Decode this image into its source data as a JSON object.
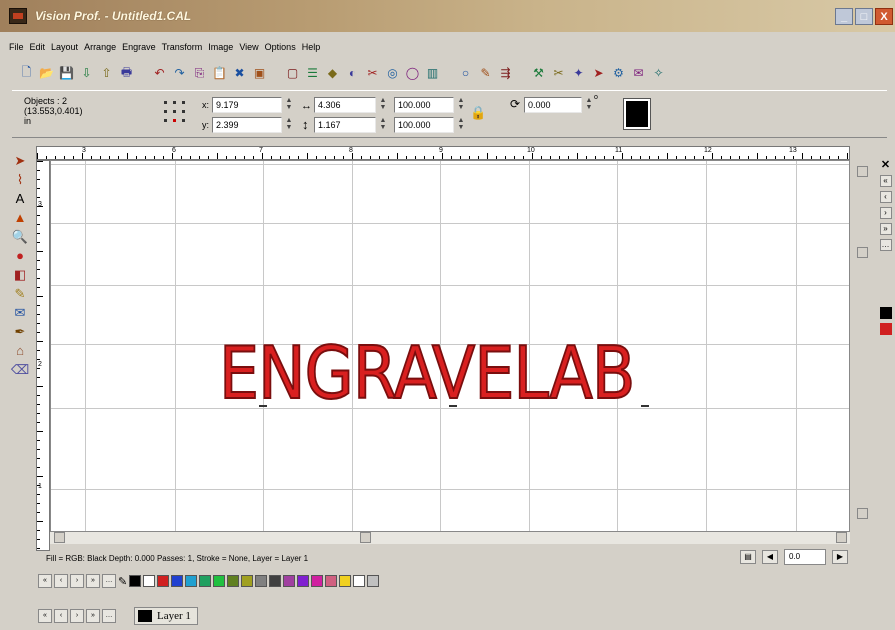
{
  "window": {
    "title": "Vision Prof. - Untitled1.CAL",
    "minimize": "_",
    "maximize": "□",
    "close": "X"
  },
  "menu": [
    "File",
    "Edit",
    "Layout",
    "Arrange",
    "Engrave",
    "Transform",
    "Image",
    "View",
    "Options",
    "Help"
  ],
  "toolbar_icons": [
    "new-icon",
    "open-icon",
    "save-icon",
    "import-icon",
    "export-icon",
    "print-icon",
    "undo-icon",
    "redo-icon",
    "copy-icon",
    "paste-icon",
    "delete-icon",
    "group-icon",
    "ungroup-icon",
    "align-icon",
    "node-icon",
    "weld-icon",
    "trim-icon",
    "intersect-icon",
    "contour-icon",
    "shadow-icon",
    "circle-icon",
    "engrave-icon",
    "output-icon",
    "tool-icon",
    "cut-icon",
    "plot-icon",
    "send-icon",
    "settings-icon",
    "mail-icon",
    "wand-icon"
  ],
  "props": {
    "objects_label": "Objects : 2",
    "objects_coords": "(13.553,0.401)",
    "objects_unit": "in",
    "x_label": "x:",
    "x_value": "9.179",
    "y_label": "y:",
    "y_value": "2.399",
    "w_value": "4.306",
    "h_value": "1.167",
    "sx_value": "100.000",
    "sy_value": "100.000",
    "rotation_value": "0.000",
    "rotation_unit": "o",
    "fill_color": "#000000"
  },
  "left_tools": [
    "pointer-icon",
    "node-edit-icon",
    "text-icon",
    "shape-icon",
    "zoom-icon",
    "fill-icon",
    "outline-icon",
    "draw-icon",
    "envelope-icon",
    "knife-icon",
    "stamp-icon",
    "eraser-icon"
  ],
  "ruler": {
    "h_labels": [
      "3",
      "6",
      "7",
      "8",
      "9",
      "10",
      "11",
      "12",
      "13"
    ],
    "v_labels": [
      "3",
      "2",
      "1"
    ]
  },
  "canvas": {
    "text": "ENGRAVELAB",
    "text_fill": "#d92020",
    "text_stroke": "#7a0e0e"
  },
  "status": {
    "text": "Fill = RGB: Black Depth: 0.000 Passes: 1, Stroke = None, Layer = Layer 1",
    "zoom_value": "0.0"
  },
  "palette_colors": [
    "#000000",
    "#ffffff",
    "#d02020",
    "#2040d0",
    "#20a0d0",
    "#20a060",
    "#20c040",
    "#608020",
    "#a0a020",
    "#808080",
    "#404040",
    "#a040a0",
    "#8020d0",
    "#d020a0",
    "#d06080",
    "#f0d020",
    "#ffffff",
    "#c0c0c0"
  ],
  "right_swatches": [
    "#000000",
    "#d02020"
  ],
  "layer": {
    "label": "Layer 1",
    "color": "#000000"
  }
}
